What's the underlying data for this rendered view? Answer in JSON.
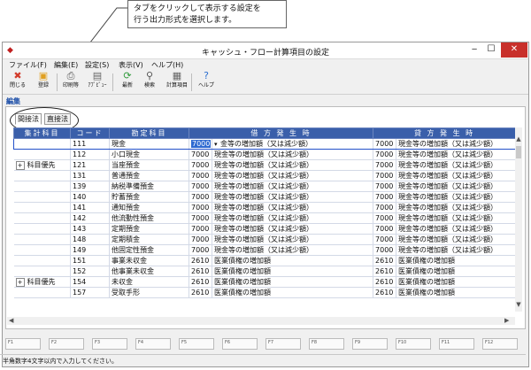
{
  "callout": {
    "line1": "タブをクリックして表示する設定を",
    "line2": "行う出力形式を選択します。"
  },
  "window": {
    "title": "キャッシュ・フロー計算項目の設定",
    "min_glyph": "‒",
    "max_glyph": "☐",
    "close_glyph": "✕"
  },
  "menu": [
    "ファイル(F)",
    "編集(E)",
    "設定(S)",
    "表示(V)",
    "ヘルプ(H)"
  ],
  "toolbar": [
    {
      "label": "閉じる",
      "icon": "close-x-icon"
    },
    {
      "label": "登録",
      "icon": "register-icon"
    },
    {
      "label": "印刷等",
      "icon": "printer-icon"
    },
    {
      "label": "ｱﾌﾟﾋﾟｭｰ",
      "icon": "preview-icon"
    },
    {
      "label": "最新",
      "icon": "refresh-icon"
    },
    {
      "label": "検索",
      "icon": "search-icon"
    },
    {
      "label": "計算項目",
      "icon": "calc-item-icon"
    },
    {
      "label": "ヘルプ",
      "icon": "help-icon"
    }
  ],
  "section_label": "編集",
  "tabs": [
    {
      "label": "間接法",
      "active": true
    },
    {
      "label": "直接法",
      "active": false
    }
  ],
  "grid": {
    "headers": [
      "集計科目",
      "コード",
      "勘定科目",
      "借 方 発 生 時",
      "貸 方 発 生 時"
    ],
    "rows": [
      {
        "group": "",
        "code": "111",
        "account": "現金",
        "debit_code": "7000",
        "debit_name": "金等の増加額（又は減少額）",
        "credit_code": "7000",
        "credit_name": "現金等の増加額（又は減少額）"
      },
      {
        "group": "",
        "code": "112",
        "account": "小口現金",
        "debit_code": "7000",
        "debit_name": "現金等の増加額（又は減少額）",
        "credit_code": "7000",
        "credit_name": "現金等の増加額（又は減少額）"
      },
      {
        "group": "科目優先",
        "code": "121",
        "account": "当座預金",
        "debit_code": "7000",
        "debit_name": "現金等の増加額（又は減少額）",
        "credit_code": "7000",
        "credit_name": "現金等の増加額（又は減少額）"
      },
      {
        "group": "",
        "code": "131",
        "account": "普通預金",
        "debit_code": "7000",
        "debit_name": "現金等の増加額（又は減少額）",
        "credit_code": "7000",
        "credit_name": "現金等の増加額（又は減少額）"
      },
      {
        "group": "",
        "code": "139",
        "account": "納税準備預金",
        "debit_code": "7000",
        "debit_name": "現金等の増加額（又は減少額）",
        "credit_code": "7000",
        "credit_name": "現金等の増加額（又は減少額）"
      },
      {
        "group": "",
        "code": "140",
        "account": "貯蓄預金",
        "debit_code": "7000",
        "debit_name": "現金等の増加額（又は減少額）",
        "credit_code": "7000",
        "credit_name": "現金等の増加額（又は減少額）"
      },
      {
        "group": "",
        "code": "141",
        "account": "通知預金",
        "debit_code": "7000",
        "debit_name": "現金等の増加額（又は減少額）",
        "credit_code": "7000",
        "credit_name": "現金等の増加額（又は減少額）"
      },
      {
        "group": "",
        "code": "142",
        "account": "他流動性預金",
        "debit_code": "7000",
        "debit_name": "現金等の増加額（又は減少額）",
        "credit_code": "7000",
        "credit_name": "現金等の増加額（又は減少額）"
      },
      {
        "group": "",
        "code": "143",
        "account": "定期預金",
        "debit_code": "7000",
        "debit_name": "現金等の増加額（又は減少額）",
        "credit_code": "7000",
        "credit_name": "現金等の増加額（又は減少額）"
      },
      {
        "group": "",
        "code": "148",
        "account": "定期積金",
        "debit_code": "7000",
        "debit_name": "現金等の増加額（又は減少額）",
        "credit_code": "7000",
        "credit_name": "現金等の増加額（又は減少額）"
      },
      {
        "group": "",
        "code": "149",
        "account": "他固定性預金",
        "debit_code": "7000",
        "debit_name": "現金等の増加額（又は減少額）",
        "credit_code": "7000",
        "credit_name": "現金等の増加額（又は減少額）"
      },
      {
        "group": "",
        "code": "151",
        "account": "事業未収金",
        "debit_code": "2610",
        "debit_name": "医業債権の増加額",
        "credit_code": "2610",
        "credit_name": "医業債権の増加額"
      },
      {
        "group": "",
        "code": "152",
        "account": "他事業未収金",
        "debit_code": "2610",
        "debit_name": "医業債権の増加額",
        "credit_code": "2610",
        "credit_name": "医業債権の増加額"
      },
      {
        "group": "科目優先",
        "code": "154",
        "account": "未収金",
        "debit_code": "2610",
        "debit_name": "医業債権の増加額",
        "credit_code": "2610",
        "credit_name": "医業債権の増加額"
      },
      {
        "group": "",
        "code": "157",
        "account": "受取手形",
        "debit_code": "2610",
        "debit_name": "医業債権の増加額",
        "credit_code": "2610",
        "credit_name": "医業債権の増加額"
      }
    ]
  },
  "fkeys": [
    "F1",
    "F2",
    "F3",
    "F4",
    "F5",
    "F6",
    "F7",
    "F8",
    "F9",
    "F10",
    "F11",
    "F12"
  ],
  "status_text": "半角数字4文字以内で入力してください。"
}
